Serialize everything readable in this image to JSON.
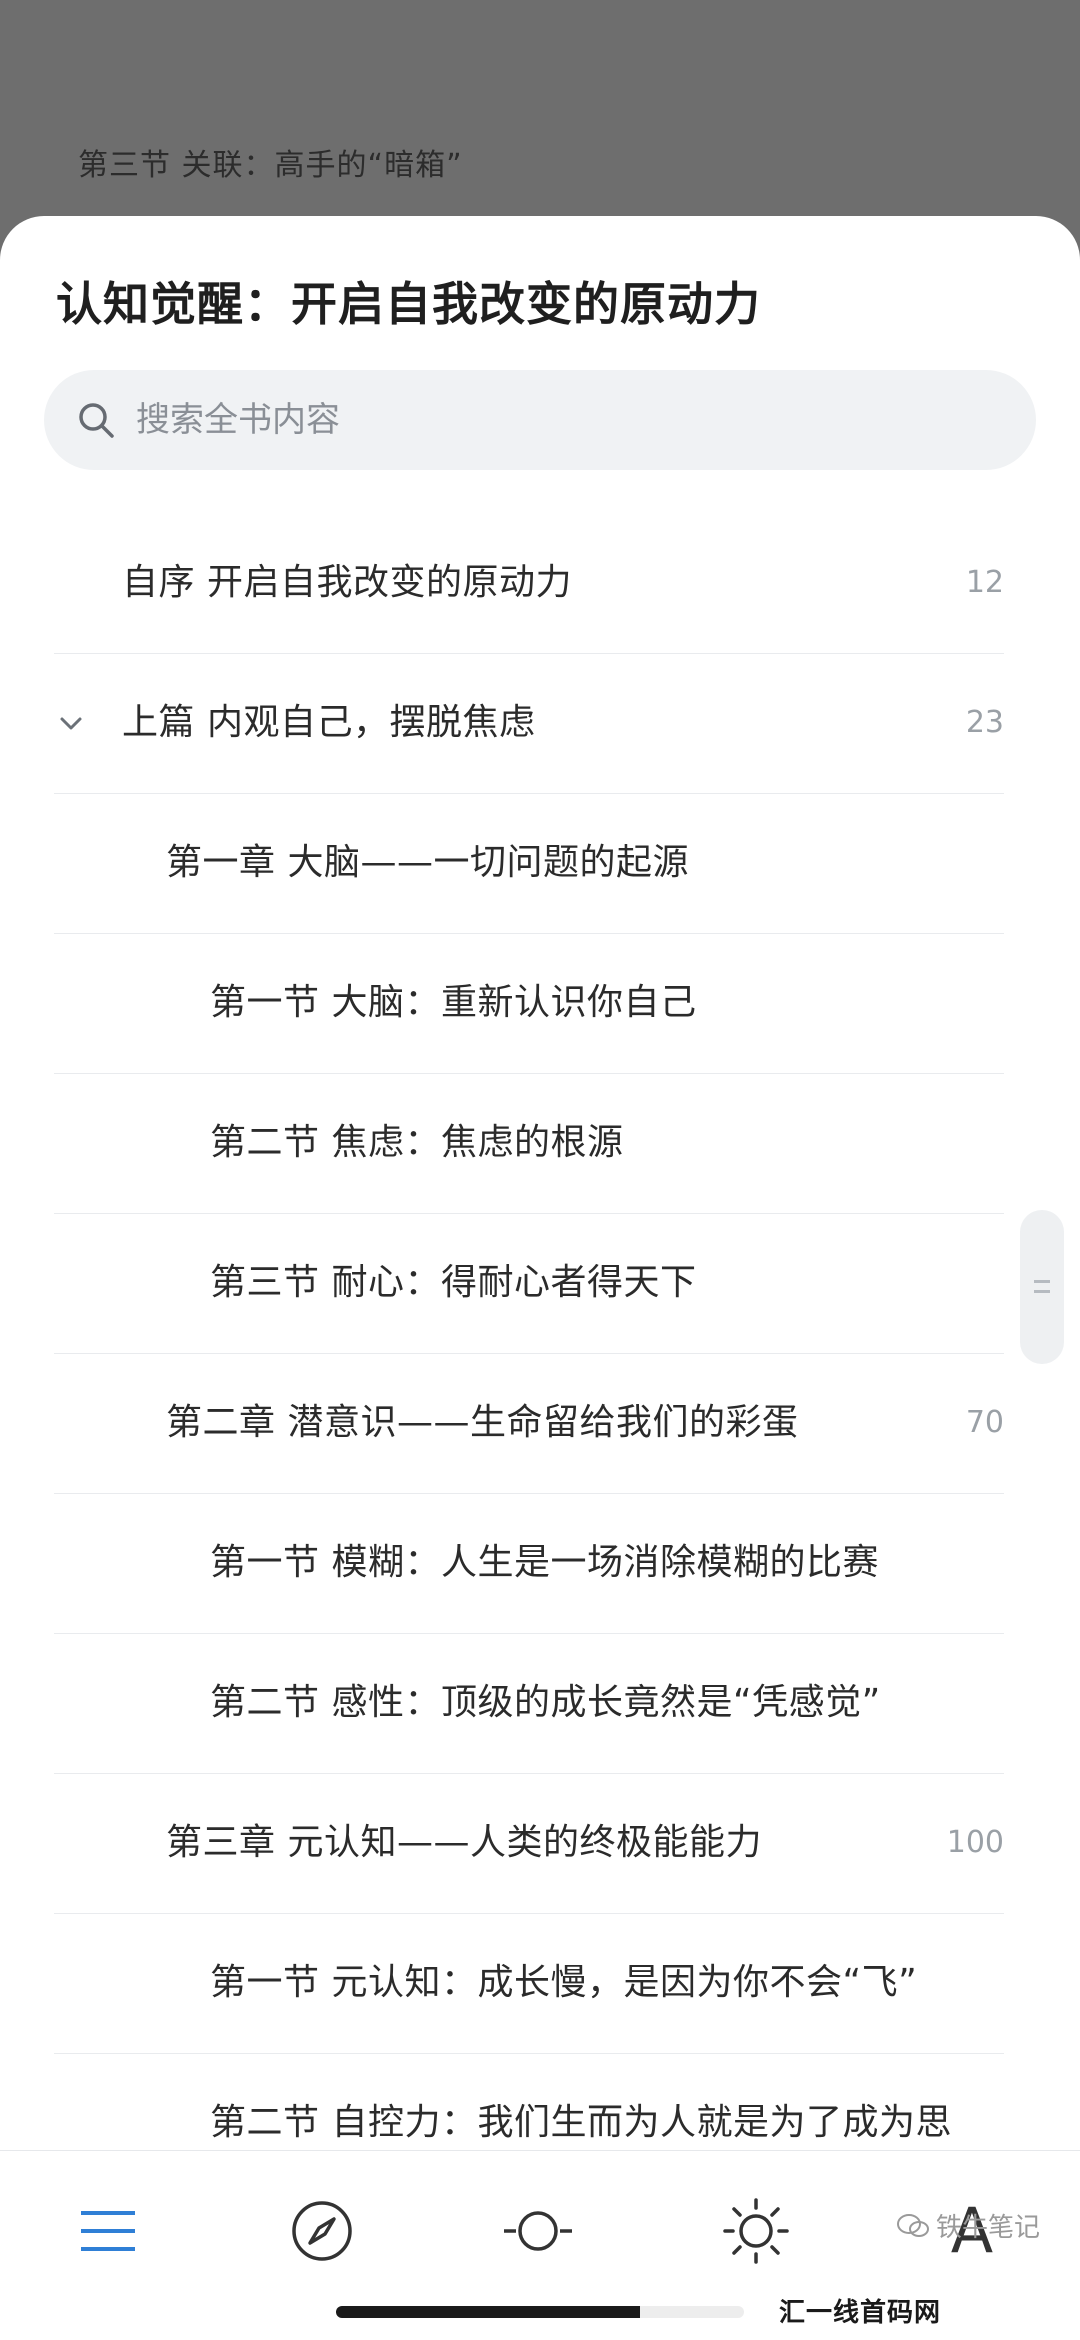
{
  "background": {
    "behind_text": "第三节 关联：高手的“暗箱”"
  },
  "sheet": {
    "title": "认知觉醒：开启自我改变的原动力",
    "search": {
      "placeholder": "搜索全书内容"
    },
    "toc": [
      {
        "label": "自序 开启自我改变的原动力",
        "page": "12",
        "level": 1,
        "expanded": false
      },
      {
        "label": "上篇 内观自己，摆脱焦虑",
        "page": "23",
        "level": 1,
        "expanded": true
      },
      {
        "label": "第一章 大脑——一切问题的起源",
        "page": "",
        "level": 2
      },
      {
        "label": "第一节 大脑：重新认识你自己",
        "page": "",
        "level": 3
      },
      {
        "label": "第二节 焦虑：焦虑的根源",
        "page": "",
        "level": 3
      },
      {
        "label": "第三节 耐心：得耐心者得天下",
        "page": "",
        "level": 3
      },
      {
        "label": "第二章 潜意识——生命留给我们的彩蛋",
        "page": "70",
        "level": 2
      },
      {
        "label": "第一节 模糊：人生是一场消除模糊的比赛",
        "page": "",
        "level": 3
      },
      {
        "label": "第二节 感性：顶级的成长竟然是“凭感觉”",
        "page": "",
        "level": 3
      },
      {
        "label": "第三章 元认知——人类的终极能能力",
        "page": "100",
        "level": 2
      },
      {
        "label": "第一节 元认知：成长慢，是因为你不会“飞”",
        "page": "",
        "level": 3
      },
      {
        "label": "第二节 自控力：我们生而为人就是为了成为思",
        "page": "",
        "level": 3
      }
    ]
  },
  "tabbar": {
    "items": [
      {
        "name": "toc",
        "icon": "menu-icon",
        "active": true
      },
      {
        "name": "progress",
        "icon": "compass-icon"
      },
      {
        "name": "slider",
        "icon": "slider-icon"
      },
      {
        "name": "brightness",
        "icon": "sun-icon"
      },
      {
        "name": "font",
        "icon": "font-icon",
        "glyph": "A"
      }
    ],
    "accent": "#2f7fd6"
  },
  "watermarks": {
    "wechat": "铁牛笔记",
    "site": "汇一线首码网 www.huiyixian.com"
  }
}
